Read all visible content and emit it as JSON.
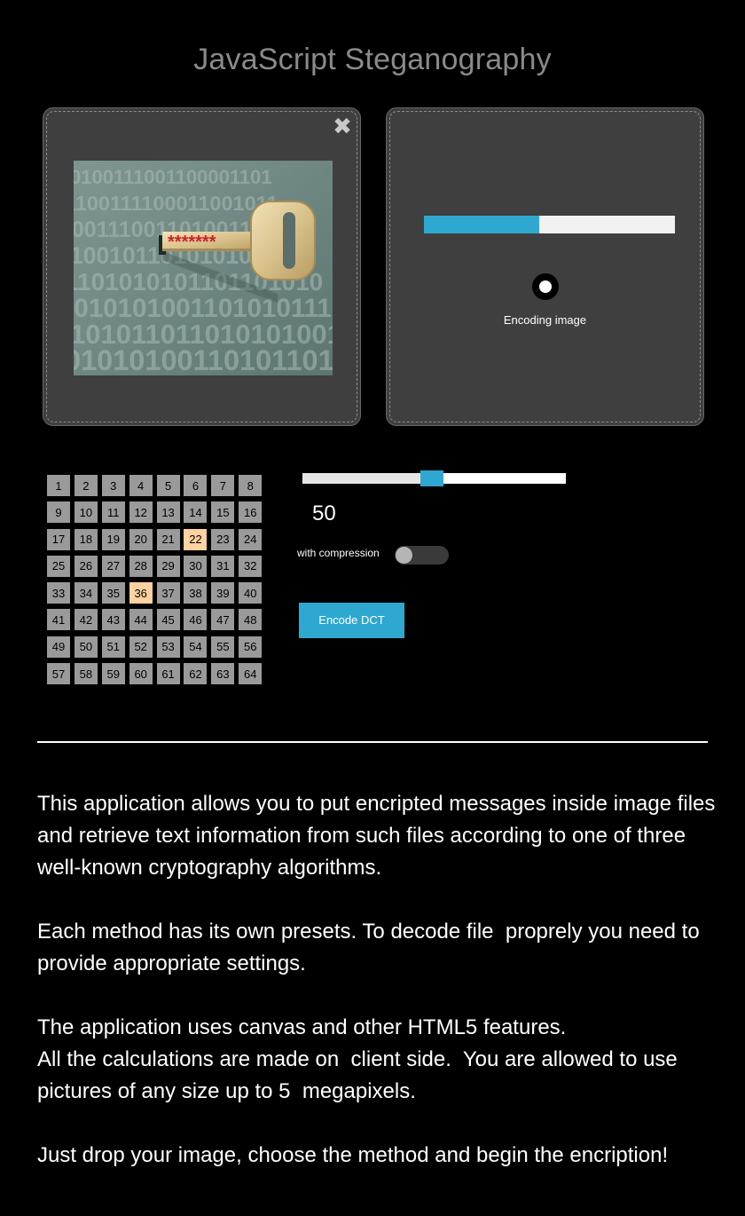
{
  "header": {
    "title": "JavaScript Steganography"
  },
  "source_panel": {
    "close_icon": "close-icon",
    "image": {
      "subject": "key-in-binary-wall",
      "mask_text": "*******",
      "binary_rows": [
        "0100111001100001101",
        "1100111100011001011",
        "0001110011010011001",
        "1001011010101001111",
        "1101010101101101010",
        "0010101001101010111",
        "1010110110101010010",
        "0101010011010110101"
      ]
    }
  },
  "result_panel": {
    "progress": 0.46,
    "status_text": "Encoding image",
    "spinner_icon": "loading-spinner-icon"
  },
  "dct_grid": {
    "cells": [
      "1",
      "2",
      "3",
      "4",
      "5",
      "6",
      "7",
      "8",
      "9",
      "10",
      "11",
      "12",
      "13",
      "14",
      "15",
      "16",
      "17",
      "18",
      "19",
      "20",
      "21",
      "22",
      "23",
      "24",
      "25",
      "26",
      "27",
      "28",
      "29",
      "30",
      "31",
      "32",
      "33",
      "34",
      "35",
      "36",
      "37",
      "38",
      "39",
      "40",
      "41",
      "42",
      "43",
      "44",
      "45",
      "46",
      "47",
      "48",
      "49",
      "50",
      "51",
      "52",
      "53",
      "54",
      "55",
      "56",
      "57",
      "58",
      "59",
      "60",
      "61",
      "62",
      "63",
      "64"
    ],
    "selected": [
      "22",
      "36"
    ]
  },
  "controls": {
    "slider_value": "50",
    "slider_fraction": 0.49,
    "compression_label": "with compression",
    "compression_enabled": false,
    "encode_label": "Encode DCT"
  },
  "description": {
    "paragraphs": [
      "This application allows you to put encripted messages inside image files and retrieve text information from such files according to one of three well-known cryptography algorithms.",
      "Each method has its own presets. To decode file  proprely you need to  provide appropriate settings.",
      "The application uses canvas and other HTML5 features.\nAll the calculations are made on  client side.  You are allowed to use pictures of any size up to 5  megapixels.",
      "Just drop your image, choose the method and begin the encription!"
    ]
  },
  "colors": {
    "accent": "#2ea8d0",
    "selected_cell": "#ffd2a0",
    "panel_bg": "#3f3f3f",
    "title": "#8a8a8a"
  }
}
